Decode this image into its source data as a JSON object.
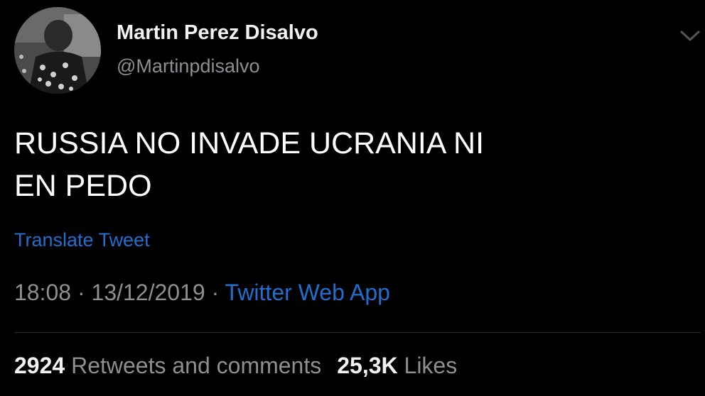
{
  "author": {
    "display_name": "Martin Perez Disalvo",
    "handle": "@Martinpdisalvo",
    "avatar_icon": "profile-photo"
  },
  "menu": {
    "icon": "chevron-down-icon"
  },
  "tweet": {
    "text_line1": "RUSSIA NO INVADE UCRANIA NI",
    "text_line2": "EN PEDO",
    "translate_label": "Translate Tweet",
    "time": "18:08",
    "date": "13/12/2019",
    "separator": "·",
    "source": "Twitter Web App"
  },
  "stats": {
    "retweets_count": "2924",
    "retweets_label": "Retweets and comments",
    "likes_count": "25,3K",
    "likes_label": "Likes"
  },
  "colors": {
    "background": "#000000",
    "link": "#1f6fd0",
    "secondary_text": "#8e8e93",
    "primary_text": "#ffffff"
  }
}
